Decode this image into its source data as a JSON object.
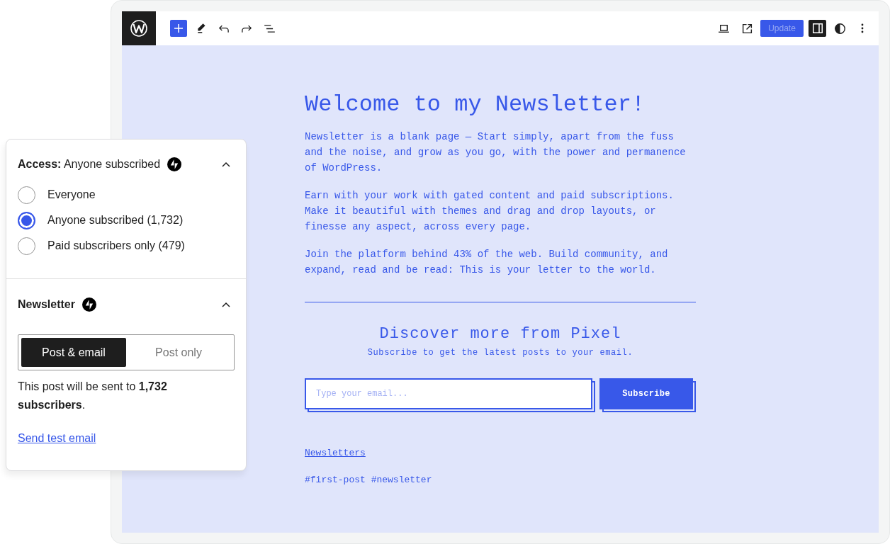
{
  "toolbar": {
    "update_button": {
      "label": "Update",
      "disabled": true
    },
    "settings_toggle": {
      "pressed": true
    }
  },
  "post": {
    "title": "Welcome to my Newsletter!",
    "paragraphs": [
      "Newsletter is a blank page — Start simply, apart from the fuss and the noise, and grow as you go, with the power and permanence of WordPress.",
      "Earn with your work with gated content and paid subscriptions. Make it beautiful with themes and drag and drop layouts, or finesse any aspect, across every page.",
      "Join the platform behind 43% of the web. Build community, and expand, read and be read: This is your letter to the world."
    ],
    "subscribe_block": {
      "heading": "Discover more from Pixel",
      "subtitle": "Subscribe to get the latest posts to your email.",
      "email_placeholder": "Type your email...",
      "button": "Subscribe"
    },
    "category": "Newsletters",
    "tags": [
      "#first-post",
      "#newsletter"
    ]
  },
  "access_panel": {
    "title": "**Access:** Anyone subscribed",
    "expanded": true,
    "options": [
      {
        "label": "Everyone",
        "selected": false
      },
      {
        "label": "Anyone subscribed (1,732)",
        "selected": true
      },
      {
        "label": "Paid subscribers only (479)",
        "selected": false
      }
    ]
  },
  "newsletter_panel": {
    "title": "Newsletter",
    "expanded": true,
    "modes": [
      {
        "label": "Post & email",
        "selected": true
      },
      {
        "label": "Post only",
        "selected": false
      }
    ],
    "note": "This post will be sent to **1,732 subscribers**.",
    "link": "Send test email"
  }
}
